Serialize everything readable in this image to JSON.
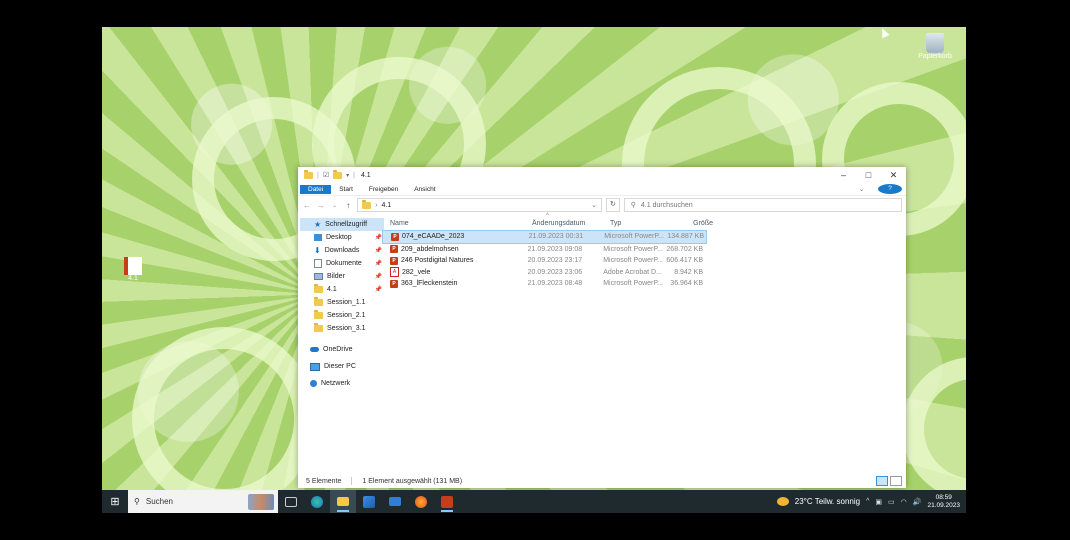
{
  "desktop": {
    "icons": [
      {
        "label": "Papierkorb",
        "icon": "recycle-bin-icon"
      },
      {
        "label": "4.1",
        "icon": "powerpoint-file-icon"
      }
    ]
  },
  "explorer": {
    "title": "4.1",
    "window_controls": {
      "minimize": "–",
      "maximize": "□",
      "close": "✕"
    },
    "ribbon_tabs": [
      "Datei",
      "Start",
      "Freigeben",
      "Ansicht"
    ],
    "address": {
      "path": "4.1",
      "separator": "›"
    },
    "search": {
      "placeholder": "4.1 durchsuchen"
    },
    "nav": {
      "quick_access": "Schnellzugriff",
      "items": [
        "Desktop",
        "Downloads",
        "Dokumente",
        "Bilder",
        "4.1",
        "Session_1.1",
        "Session_2.1",
        "Session_3.1"
      ],
      "onedrive": "OneDrive",
      "this_pc": "Dieser PC",
      "network": "Netzwerk"
    },
    "columns": {
      "name": "Name",
      "date": "Änderungsdatum",
      "type": "Typ",
      "size": "Größe"
    },
    "files": [
      {
        "name": "074_eCAADe_2023",
        "date": "21.09.2023 00:31",
        "type": "Microsoft PowerP...",
        "size": "134.887 KB",
        "icon": "ppt",
        "selected": true
      },
      {
        "name": "209_abdelmohsen",
        "date": "21.09.2023 09:08",
        "type": "Microsoft PowerP...",
        "size": "268.702 KB",
        "icon": "ppt",
        "selected": false
      },
      {
        "name": "246 Postdigital Natures",
        "date": "20.09.2023 23:17",
        "type": "Microsoft PowerP...",
        "size": "606.417 KB",
        "icon": "ppt",
        "selected": false
      },
      {
        "name": "282_vele",
        "date": "20.09.2023 23:06",
        "type": "Adobe Acrobat D...",
        "size": "8.942 KB",
        "icon": "pdf",
        "selected": false
      },
      {
        "name": "363_lFleckenstein",
        "date": "21.09.2023 08:48",
        "type": "Microsoft PowerP...",
        "size": "36.964 KB",
        "icon": "ppt",
        "selected": false
      }
    ],
    "status": {
      "count": "5 Elemente",
      "selection": "1 Element ausgewählt (131 MB)"
    }
  },
  "taskbar": {
    "search_placeholder": "Suchen",
    "apps": [
      "task-view-icon",
      "edge-icon",
      "file-explorer-icon",
      "store-icon",
      "mail-icon",
      "firefox-icon",
      "powerpoint-icon"
    ],
    "weather": "23°C  Teilw. sonnig",
    "time": "08:59",
    "date": "21.09.2023"
  },
  "colors": {
    "accent": "#1979ca",
    "selection": "#cce4f7",
    "taskbar": "#1f2a2e"
  }
}
